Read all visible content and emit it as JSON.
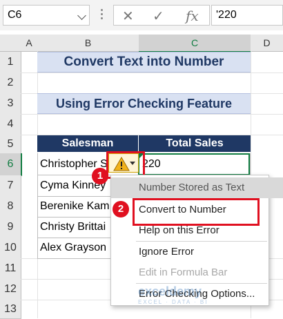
{
  "formula_bar": {
    "name_box": "C6",
    "cancel_icon": "close-icon",
    "enter_icon": "check-icon",
    "fx_label": "fx",
    "formula_value": "'220"
  },
  "columns": [
    "A",
    "B",
    "C",
    "D"
  ],
  "rows": [
    "1",
    "2",
    "3",
    "4",
    "5",
    "6",
    "7",
    "8",
    "9",
    "10",
    "11",
    "12",
    "13"
  ],
  "sheet": {
    "title": "Convert Text into Number",
    "subtitle": "Using Error Checking Feature",
    "table": {
      "headers": [
        "Salesman",
        "Total Sales"
      ],
      "salesmen": [
        "Christopher S",
        "Cyma Kinney",
        "Berenike Kam",
        "Christy Brittai",
        "Alex Grayson"
      ],
      "c6_value": "220"
    }
  },
  "context_menu": {
    "header": "Number Stored as Text",
    "items": [
      {
        "label": "Convert to Number",
        "disabled": false
      },
      {
        "label": "Help on this Error",
        "disabled": false
      },
      {
        "label": "Ignore Error",
        "disabled": false
      },
      {
        "label": "Edit in Formula Bar",
        "disabled": true
      },
      {
        "label": "Error Checking Options...",
        "disabled": false
      }
    ]
  },
  "annotations": {
    "badge1": "1",
    "badge2": "2",
    "highlight_color": "#e01020"
  },
  "watermark": {
    "name": "exceldemy",
    "tagline": "EXCEL · DATA · BI"
  },
  "colors": {
    "accent_green": "#107c41",
    "header_navy": "#1f3864",
    "banner_blue": "#d9e1f2"
  }
}
